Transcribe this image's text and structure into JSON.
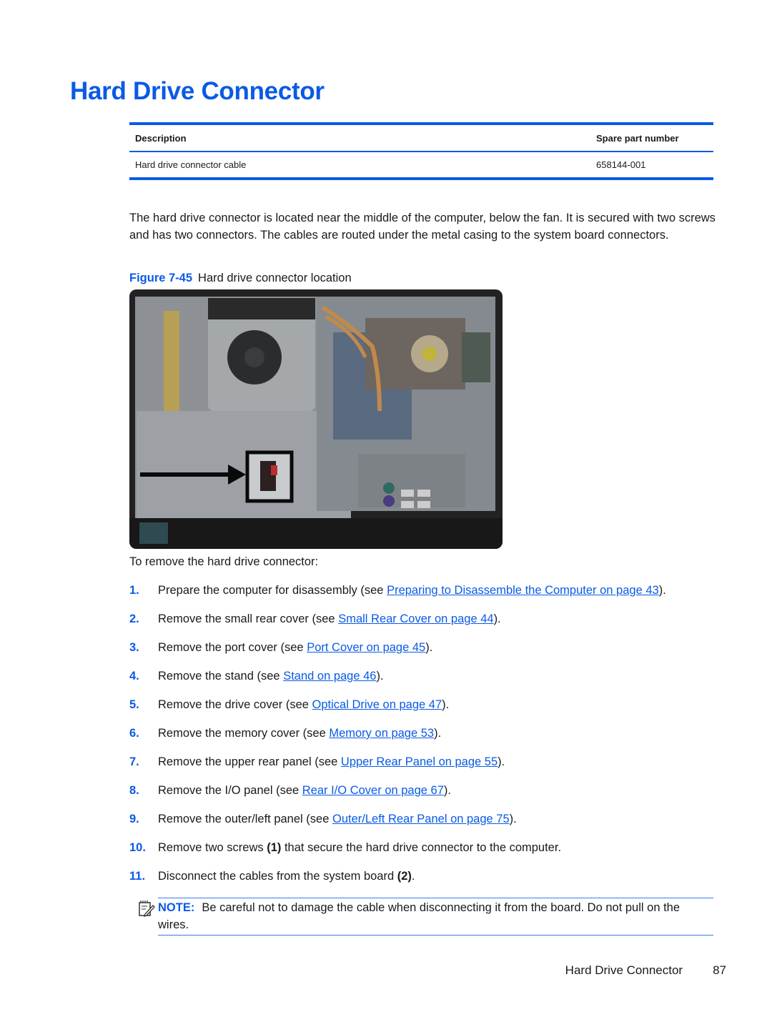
{
  "page": {
    "title": "Hard Drive Connector",
    "table": {
      "headers": [
        "Description",
        "Spare part number"
      ],
      "rows": [
        {
          "description": "Hard drive connector cable",
          "part_number": "658144-001"
        }
      ]
    },
    "paragraph": "The hard drive connector is located near the middle of the computer, below the fan. It is secured with two screws and has two connectors. The cables are routed under the metal casing to the system board connectors.",
    "figure": {
      "label": "Figure 7-45",
      "caption": "Hard drive connector location",
      "image_description": "Rear view of opened all-in-one computer with hard drive connector highlighted by black box and arrow"
    },
    "intro": "To remove the hard drive connector:",
    "steps": [
      {
        "num": "1.",
        "pre": "Prepare the computer for disassembly (see ",
        "link": "Preparing to Disassemble the Computer on page 43",
        "post": ")."
      },
      {
        "num": "2.",
        "pre": "Remove the small rear cover (see ",
        "link": "Small Rear Cover on page 44",
        "post": ")."
      },
      {
        "num": "3.",
        "pre": "Remove the port cover (see ",
        "link": "Port Cover on page 45",
        "post": ")."
      },
      {
        "num": "4.",
        "pre": "Remove the stand (see ",
        "link": "Stand on page 46",
        "post": ")."
      },
      {
        "num": "5.",
        "pre": "Remove the drive cover (see ",
        "link": "Optical Drive on page 47",
        "post": ")."
      },
      {
        "num": "6.",
        "pre": "Remove the memory cover (see ",
        "link": "Memory on page 53",
        "post": ")."
      },
      {
        "num": "7.",
        "pre": "Remove the upper rear panel (see ",
        "link": "Upper Rear Panel on page 55",
        "post": ")."
      },
      {
        "num": "8.",
        "pre": "Remove the I/O panel (see ",
        "link": "Rear I/O Cover on page 67",
        "post": ")."
      },
      {
        "num": "9.",
        "pre": "Remove the outer/left panel (see ",
        "link": "Outer/Left Rear Panel on page 75",
        "post": ")."
      },
      {
        "num": "10.",
        "pre": "Remove two screws ",
        "bold": "(1)",
        "post": " that secure the hard drive connector to the computer."
      },
      {
        "num": "11.",
        "pre": "Disconnect the cables from the system board ",
        "bold": "(2)",
        "post": "."
      }
    ],
    "note": {
      "label": "NOTE:",
      "text": "Be careful not to damage the cable when disconnecting it from the board. Do not pull on the wires."
    },
    "footer": {
      "section": "Hard Drive Connector",
      "page_number": "87"
    },
    "colors": {
      "accent": "#0a5ae6"
    }
  }
}
